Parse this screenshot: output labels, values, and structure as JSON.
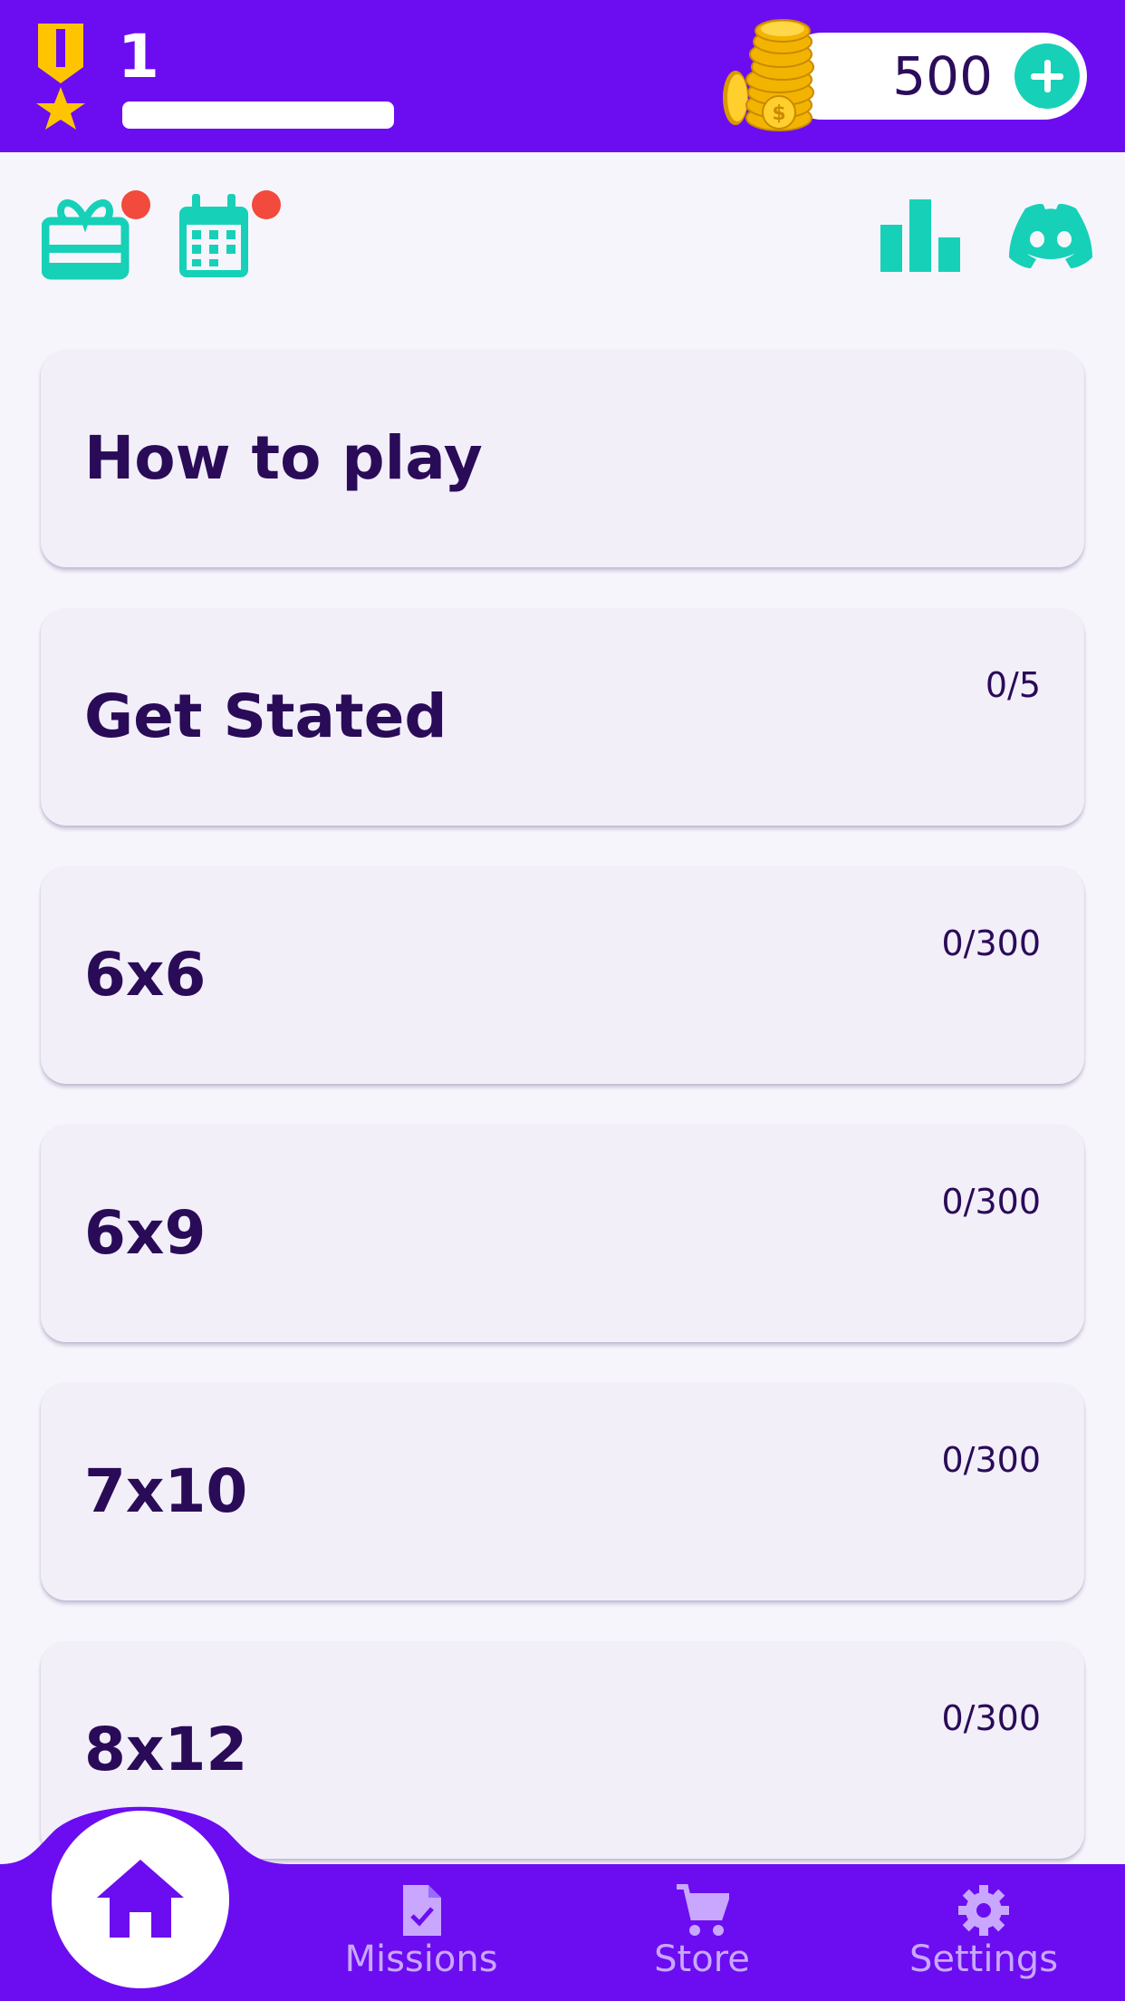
{
  "header": {
    "level": "1",
    "xp_progress": 0,
    "coins": "500",
    "icons": {
      "medal": "medal-icon",
      "coins": "coin-stack-icon",
      "add": "add-coins-icon"
    }
  },
  "quick_actions": {
    "left": [
      {
        "name": "gift-icon",
        "has_notification": true
      },
      {
        "name": "calendar-icon",
        "has_notification": true
      }
    ],
    "right": [
      {
        "name": "leaderboard-icon"
      },
      {
        "name": "discord-icon"
      }
    ]
  },
  "menu": [
    {
      "title": "How to play",
      "progress": ""
    },
    {
      "title": "Get Stated",
      "progress": "0/5"
    },
    {
      "title": "6x6",
      "progress": "0/300"
    },
    {
      "title": "6x9",
      "progress": "0/300"
    },
    {
      "title": "7x10",
      "progress": "0/300"
    },
    {
      "title": "8x12",
      "progress": "0/300"
    }
  ],
  "bottom_nav": {
    "home": {
      "icon": "home-icon",
      "active": true
    },
    "items": [
      {
        "label": "Missions",
        "icon": "missions-icon"
      },
      {
        "label": "Store",
        "icon": "cart-icon"
      },
      {
        "label": "Settings",
        "icon": "gear-icon"
      }
    ]
  },
  "colors": {
    "primary": "#6b0df0",
    "accent": "#16d1b8",
    "notification": "#f24a3c",
    "text_dark": "#2a0b58",
    "nav_inactive": "#c9a7ff",
    "medal": "#ffc400"
  }
}
